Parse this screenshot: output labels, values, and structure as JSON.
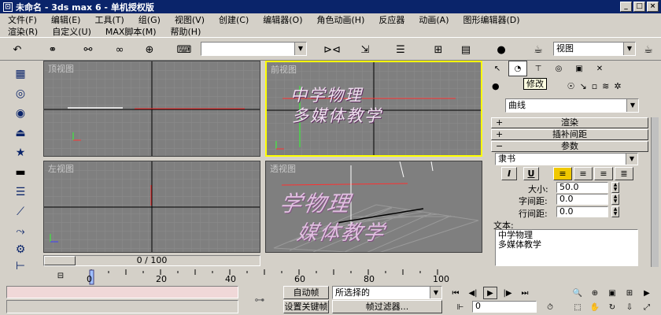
{
  "window": {
    "title": "未命名 - 3ds max 6 - 单机授权版"
  },
  "menu": {
    "row1": [
      "文件(F)",
      "编辑(E)",
      "工具(T)",
      "组(G)",
      "视图(V)",
      "创建(C)",
      "编辑器(O)",
      "角色动画(H)",
      "反应器",
      "动画(A)",
      "图形编辑器(D)"
    ],
    "row2": [
      "渲染(R)",
      "自定义(U)",
      "MAX脚本(M)",
      "帮助(H)"
    ]
  },
  "toolbar": {
    "selection_filter": "",
    "view_select": "视图"
  },
  "viewports": {
    "top": "顶视图",
    "front": "前视图",
    "left": "左视图",
    "perspective": "透视图",
    "front_text_line1": "中学物理",
    "front_text_line2": "多媒体教学",
    "persp_text_line1": "学物理",
    "persp_text_line2": "媒体教学"
  },
  "command_panel": {
    "tooltip": "修改",
    "object_type": "曲线",
    "rollouts": {
      "render": "渲染",
      "interp": "插补间距",
      "params": "参数"
    },
    "font": "隶书",
    "style_buttons": {
      "italic": "I",
      "underline": "U"
    },
    "fields": {
      "size_label": "大小:",
      "size_value": "50.0",
      "kerning_label": "字间距:",
      "kerning_value": "0.0",
      "leading_label": "行间距:",
      "leading_value": "0.0"
    },
    "text_label": "文本:",
    "text_lines": [
      "中学物理",
      "多媒体教学"
    ]
  },
  "timeline": {
    "frame_display": "0 / 100",
    "ticks": [
      "0",
      "20",
      "40",
      "60",
      "80",
      "100"
    ],
    "slider_fraction": 0.0
  },
  "status": {
    "auto_key": "自动帧",
    "set_key": "设置关键帧",
    "selection_set": "所选择的",
    "key_filters": "帧过滤器...",
    "frame_field": "0"
  },
  "colors": {
    "titlebar": "#0a246a",
    "viewport_bg": "#7f7f7f",
    "active_border": "#ffff00",
    "text_pink": "#e0c0e0",
    "axis_red": "#ff3030"
  }
}
